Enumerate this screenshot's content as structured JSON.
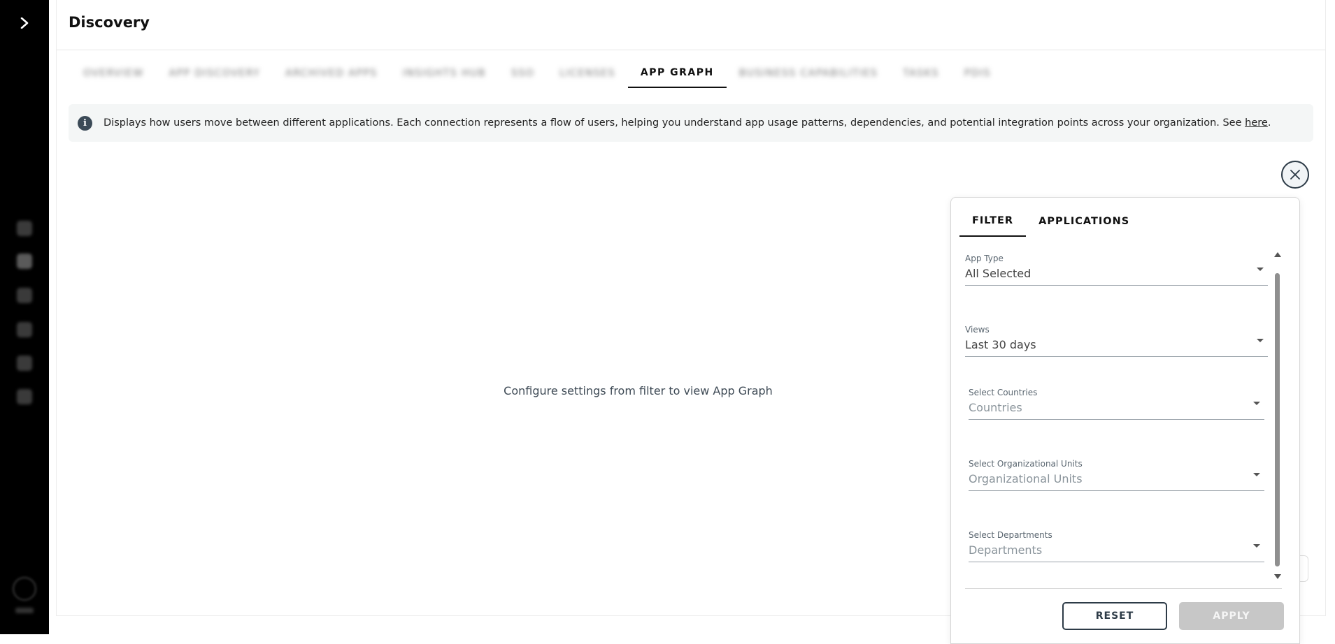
{
  "sidebar": {
    "expand_icon": "chevron-right-icon",
    "nav_icons": [
      "dashboard-icon",
      "search-icon",
      "plus-icon",
      "chart-icon",
      "star-icon",
      "settings-icon"
    ],
    "user_avatar_icon": "avatar-icon"
  },
  "header": {
    "title": "Discovery"
  },
  "tabs": [
    {
      "label": "OVERVIEW",
      "blurred": true
    },
    {
      "label": "APP DISCOVERY",
      "blurred": true
    },
    {
      "label": "ARCHIVED APPS",
      "blurred": true
    },
    {
      "label": "INSIGHTS HUB",
      "blurred": true
    },
    {
      "label": "SSO",
      "blurred": true
    },
    {
      "label": "LICENSES",
      "blurred": true
    },
    {
      "label": "APP GRAPH",
      "blurred": false,
      "active": true
    },
    {
      "label": "BUSINESS CAPABILITIES",
      "blurred": true
    },
    {
      "label": "TASKS",
      "blurred": true
    },
    {
      "label": "PDIS",
      "blurred": true
    }
  ],
  "info_banner": {
    "icon": "info-icon",
    "text": "Displays how users move between different applications. Each connection represents a flow of users, helping you understand app usage patterns, dependencies, and potential integration points across your organization. See ",
    "link_text": "here",
    "suffix": "."
  },
  "main": {
    "empty_message": "Configure settings from filter to view App Graph",
    "close_icon": "close-icon"
  },
  "filter_panel": {
    "tabs": [
      "FILTER",
      "APPLICATIONS"
    ],
    "active_tab": "FILTER",
    "fields": [
      {
        "label": "App Type",
        "value": "All Selected",
        "placeholder": false
      },
      {
        "label": "Views",
        "value": "Last 30 days",
        "placeholder": false
      },
      {
        "label": "Select Countries",
        "value": "Countries",
        "placeholder": true
      },
      {
        "label": "Select Organizational Units",
        "value": "Organizational Units",
        "placeholder": true
      },
      {
        "label": "Select Departments",
        "value": "Departments",
        "placeholder": true
      }
    ],
    "reset_label": "RESET",
    "apply_label": "APPLY",
    "apply_disabled": true
  },
  "colors": {
    "sidebar_bg": "#000000",
    "accent": "#2d3b47",
    "banner_bg": "#f4f6f6",
    "apply_disabled_bg": "#c7c7c7"
  }
}
